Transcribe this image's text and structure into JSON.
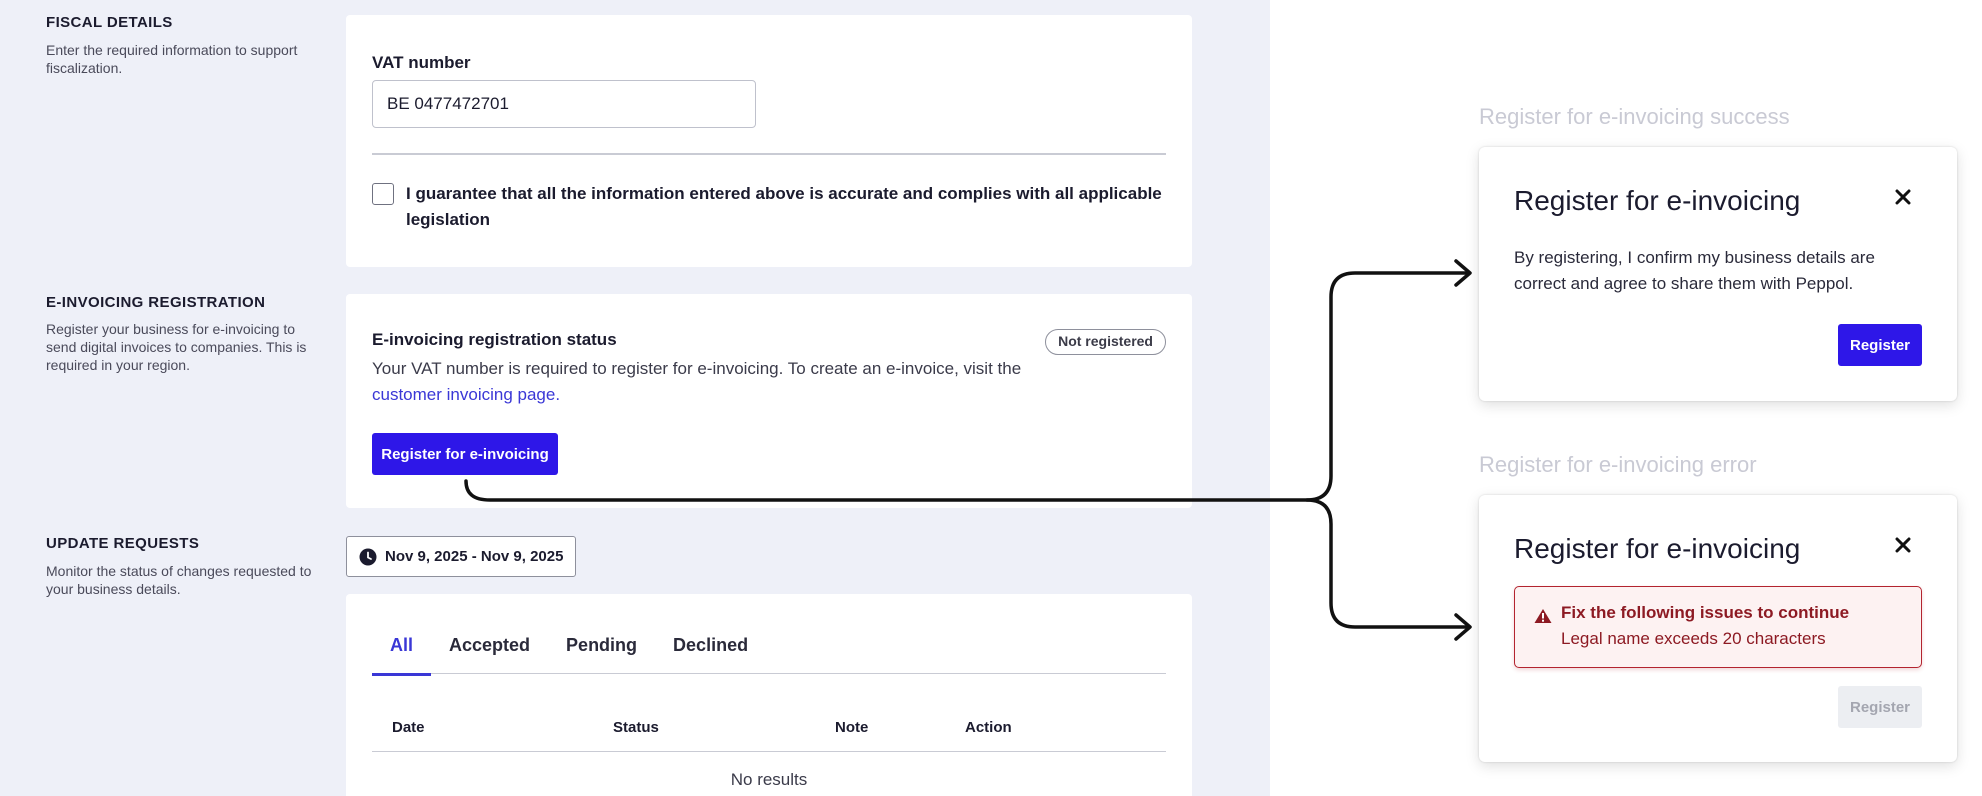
{
  "fiscal": {
    "title": "FISCAL DETAILS",
    "description": "Enter the required information to support fiscalization.",
    "vat_label": "VAT number",
    "vat_value": "BE 0477472701",
    "guarantee_text": "I guarantee that all the information entered above is accurate and complies with all applicable legislation"
  },
  "einvoicing": {
    "title": "E-INVOICING REGISTRATION",
    "description": "Register your business for e-invoicing to send digital invoices to companies. This is required in your region.",
    "status_title": "E-invoicing registration status",
    "status_badge": "Not registered",
    "status_desc": "Your VAT number is required to register for e-invoicing. To create an e-invoice, visit the ",
    "link_text": "customer invoicing page.",
    "register_button": "Register for e-invoicing"
  },
  "updates": {
    "title": "UPDATE REQUESTS",
    "description": "Monitor the status of changes requested to your business details.",
    "date_range": "Nov 9, 2025 - Nov 9, 2025",
    "tabs": [
      {
        "label": "All",
        "active": true
      },
      {
        "label": "Accepted",
        "active": false
      },
      {
        "label": "Pending",
        "active": false
      },
      {
        "label": "Declined",
        "active": false
      }
    ],
    "columns": [
      "Date",
      "Status",
      "Note",
      "Action"
    ],
    "empty_text": "No results"
  },
  "modal_success": {
    "caption": "Register for e-invoicing success",
    "title": "Register for e-invoicing",
    "body": "By registering, I confirm my business details are correct and agree to share them with Peppol.",
    "button": "Register"
  },
  "modal_error": {
    "caption": "Register for e-invoicing error",
    "title": "Register for e-invoicing",
    "alert_title": "Fix the following issues to continue",
    "alert_detail": "Legal name exceeds 20 characters",
    "button": "Register"
  },
  "colors": {
    "primary": "#2e17e8",
    "link": "#3a37d6",
    "error": "#b3242f",
    "page_bg": "#eef0f8"
  }
}
